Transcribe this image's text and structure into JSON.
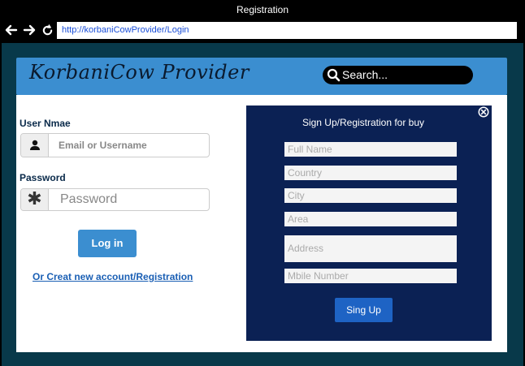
{
  "window": {
    "title": "Registration"
  },
  "browser": {
    "url": "http://korbaniCowProvider/Login"
  },
  "header": {
    "logo": "KorbaniCow Provider",
    "search_placeholder": "Search..."
  },
  "login": {
    "username_label": "User Nmae",
    "username_placeholder": "Email or Username",
    "password_label": "Password",
    "password_placeholder": "Password",
    "login_button": "Log in",
    "register_link": "Or Creat new account/Registration"
  },
  "signup": {
    "title": "Sign Up/Registration for buy",
    "fields": [
      "Full Name",
      "Country",
      "City",
      "Area",
      "Address",
      "Mbile Number"
    ],
    "submit_button": "Sing Up"
  },
  "colors": {
    "header_bg": "#3b8ed0",
    "modal_bg": "#0b2154",
    "page_bg": "#08394a",
    "link": "#1a5fb4"
  }
}
